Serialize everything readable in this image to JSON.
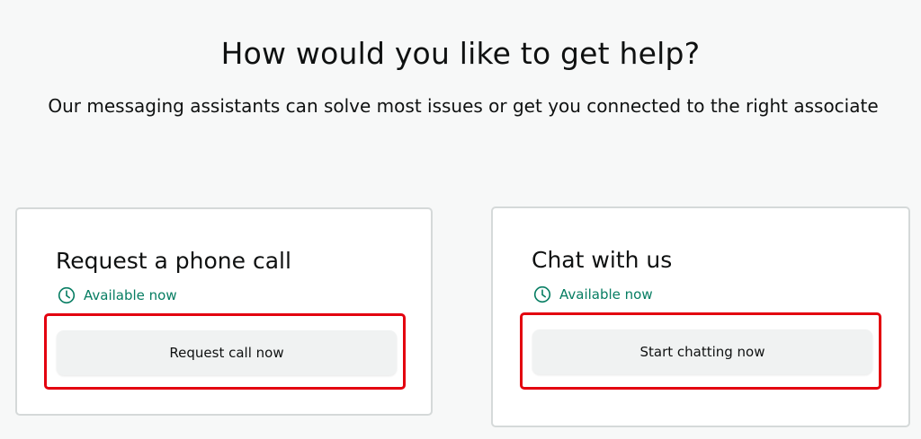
{
  "page": {
    "heading": "How would you like to get help?",
    "subheading": "Our messaging assistants can solve most issues or get you connected to the right associate"
  },
  "options": [
    {
      "title": "Request a phone call",
      "status": "Available now",
      "status_icon": "clock-icon",
      "button_label": "Request call now"
    },
    {
      "title": "Chat with us",
      "status": "Available now",
      "status_icon": "clock-icon",
      "button_label": "Start chatting now"
    }
  ],
  "colors": {
    "background": "#f7f8f8",
    "status_green": "#067d62",
    "highlight_red": "#e3000f",
    "button_bg": "#f0f2f2"
  }
}
